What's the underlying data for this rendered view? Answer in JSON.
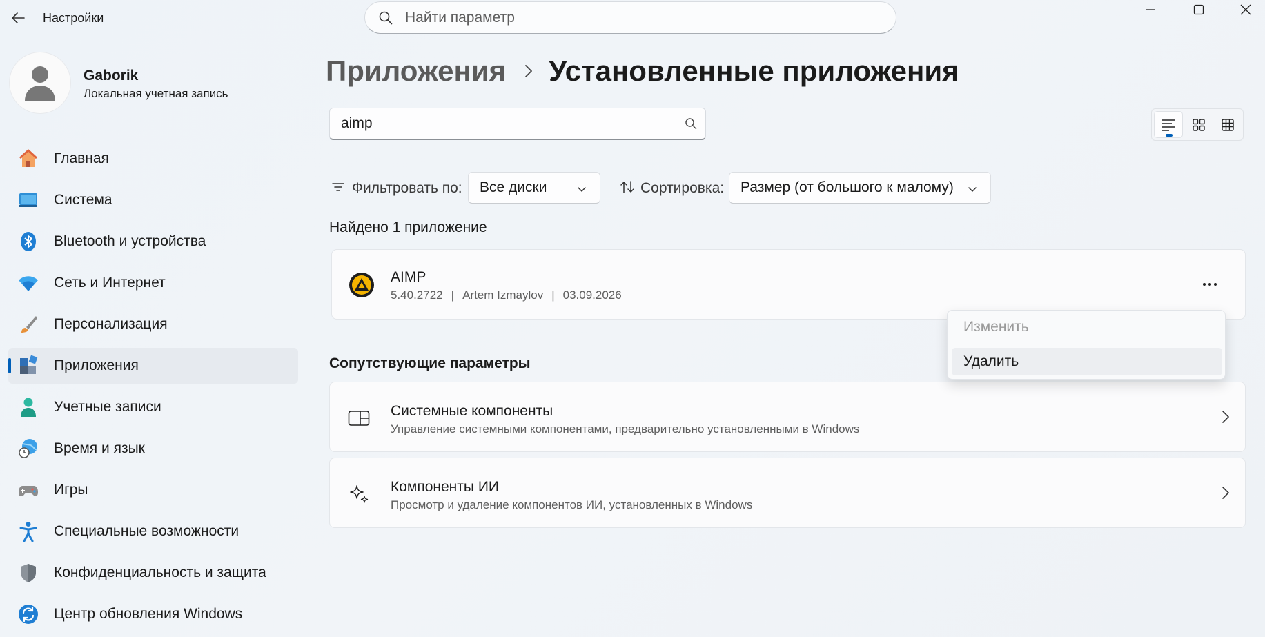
{
  "window": {
    "app_title": "Настройки",
    "search_placeholder": "Найти параметр",
    "icons": {
      "back": "back-arrow-icon",
      "minimize": "minimize-icon",
      "maximize": "maximize-icon",
      "close": "close-icon",
      "search": "search-icon"
    }
  },
  "profile": {
    "name": "Gaborik",
    "account_type": "Локальная учетная запись"
  },
  "sidebar": {
    "items": [
      {
        "label": "Главная",
        "icon": "home-icon"
      },
      {
        "label": "Система",
        "icon": "system-display-icon"
      },
      {
        "label": "Bluetooth и устройства",
        "icon": "bluetooth-icon"
      },
      {
        "label": "Сеть и Интернет",
        "icon": "wifi-icon"
      },
      {
        "label": "Персонализация",
        "icon": "brush-icon"
      },
      {
        "label": "Приложения",
        "icon": "apps-icon",
        "active": true
      },
      {
        "label": "Учетные записи",
        "icon": "person-icon"
      },
      {
        "label": "Время и язык",
        "icon": "globe-clock-icon"
      },
      {
        "label": "Игры",
        "icon": "gamepad-icon"
      },
      {
        "label": "Специальные возможности",
        "icon": "accessibility-icon"
      },
      {
        "label": "Конфиденциальность и защита",
        "icon": "shield-icon"
      },
      {
        "label": "Центр обновления Windows",
        "icon": "update-icon"
      }
    ]
  },
  "main": {
    "breadcrumb": {
      "parent": "Приложения",
      "current": "Установленные приложения"
    },
    "app_search": {
      "value": "aimp"
    },
    "view_modes": [
      "list-view-icon",
      "grid-view-icon",
      "table-view-icon"
    ],
    "filter": {
      "label": "Фильтровать по:",
      "value": "Все диски"
    },
    "sort": {
      "label": "Сортировка:",
      "value": "Размер (от большого к малому)"
    },
    "found_text": "Найдено 1 приложение",
    "apps": [
      {
        "name": "AIMP",
        "version": "5.40.2722",
        "publisher": "Artem Izmaylov",
        "date": "03.09.2026",
        "separator": "|",
        "icon": "aimp-logo-icon"
      }
    ],
    "context_menu": {
      "items": [
        "Изменить",
        "Удалить"
      ]
    },
    "related": {
      "title": "Сопутствующие параметры",
      "items": [
        {
          "title": "Системные компоненты",
          "description": "Управление системными компонентами, предварительно установленными в Windows",
          "icon": "system-components-icon"
        },
        {
          "title": "Компоненты ИИ",
          "description": "Просмотр и удаление компонентов ИИ, установленных в Windows",
          "icon": "sparkle-icon"
        }
      ]
    }
  },
  "colors": {
    "accent": "#005fb8",
    "aimp_yellow": "#f5b400"
  }
}
